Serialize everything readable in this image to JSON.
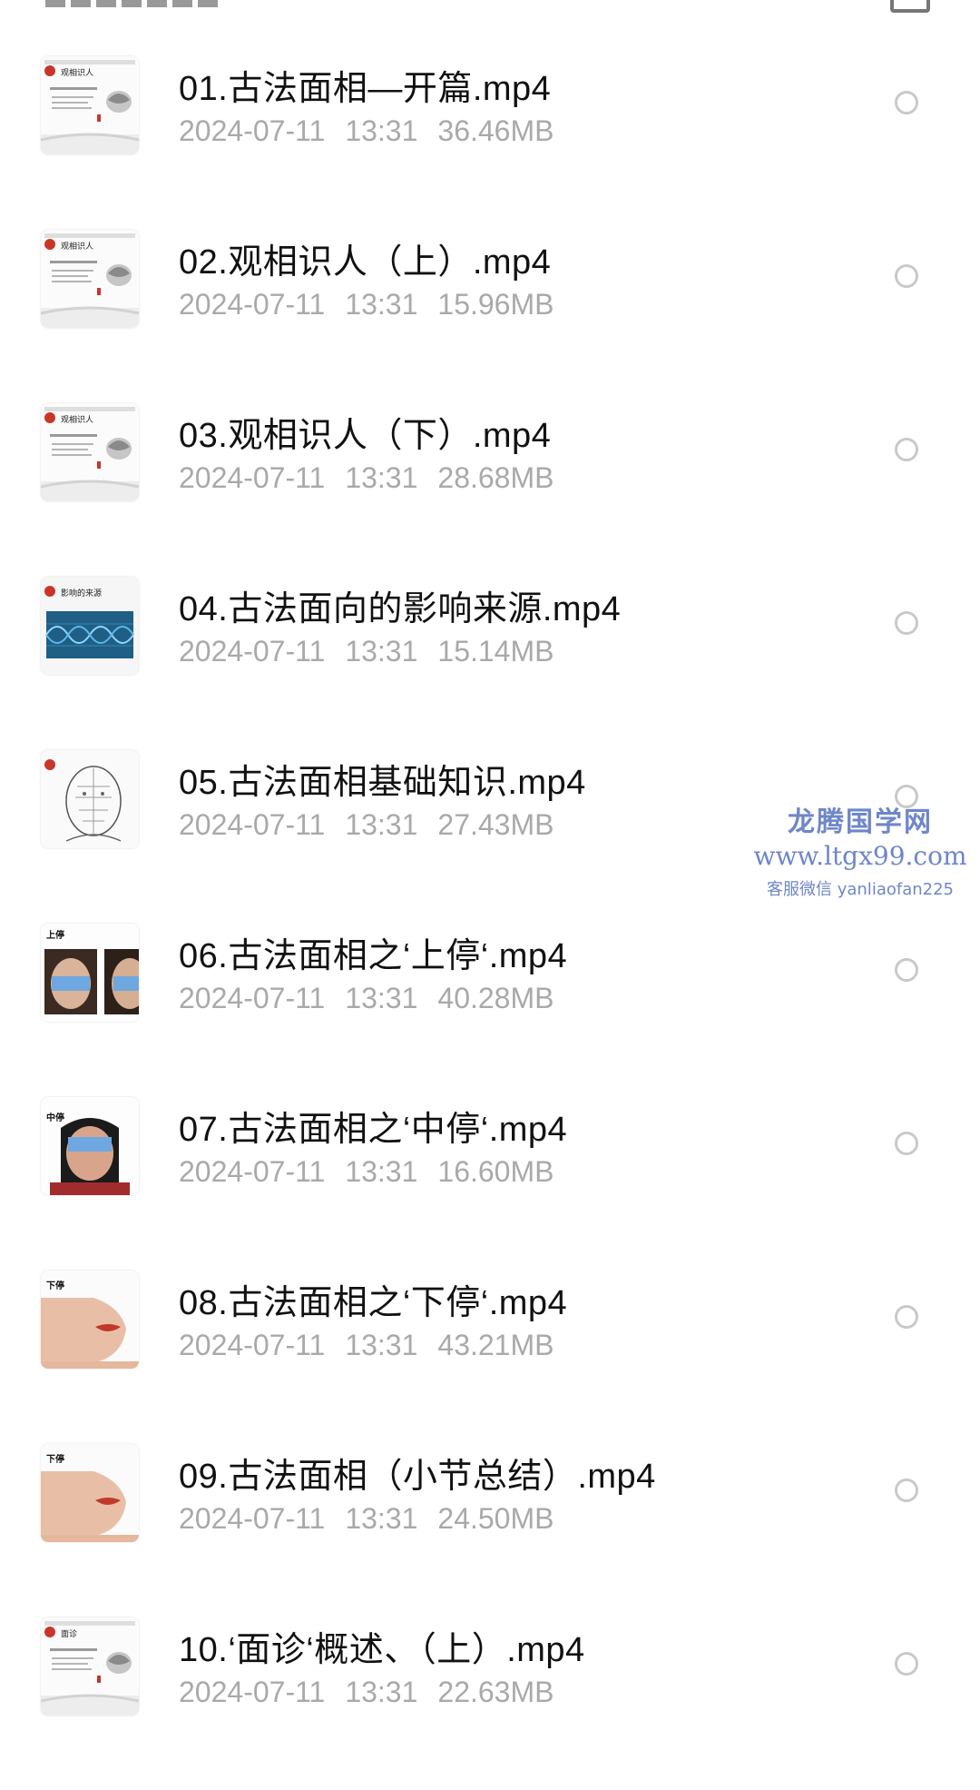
{
  "files": [
    {
      "name": "01.古法面相—开篇.mp4",
      "date": "2024-07-11",
      "time": "13:31",
      "size": "36.46MB",
      "thumb_label": "观相识人",
      "thumb_type": "slide"
    },
    {
      "name": "02.观相识人（上）.mp4",
      "date": "2024-07-11",
      "time": "13:31",
      "size": "15.96MB",
      "thumb_label": "观相识人",
      "thumb_type": "slide"
    },
    {
      "name": "03.观相识人（下）.mp4",
      "date": "2024-07-11",
      "time": "13:31",
      "size": "28.68MB",
      "thumb_label": "观相识人",
      "thumb_type": "slide"
    },
    {
      "name": "04.古法面向的影响来源.mp4",
      "date": "2024-07-11",
      "time": "13:31",
      "size": "15.14MB",
      "thumb_label": "影响的来源",
      "thumb_type": "dna"
    },
    {
      "name": "05.古法面相基础知识.mp4",
      "date": "2024-07-11",
      "time": "13:31",
      "size": "27.43MB",
      "thumb_label": "",
      "thumb_type": "face-chart"
    },
    {
      "name": "06.古法面相之‘上停‘.mp4",
      "date": "2024-07-11",
      "time": "13:31",
      "size": "40.28MB",
      "thumb_label": "上停",
      "thumb_type": "photo-faces"
    },
    {
      "name": "07.古法面相之‘中停‘.mp4",
      "date": "2024-07-11",
      "time": "13:31",
      "size": "16.60MB",
      "thumb_label": "中停",
      "thumb_type": "photo-face"
    },
    {
      "name": "08.古法面相之‘下停‘.mp4",
      "date": "2024-07-11",
      "time": "13:31",
      "size": "43.21MB",
      "thumb_label": "下停",
      "thumb_type": "chin"
    },
    {
      "name": "09.古法面相（小节总结）.mp4",
      "date": "2024-07-11",
      "time": "13:31",
      "size": "24.50MB",
      "thumb_label": "下停",
      "thumb_type": "chin"
    },
    {
      "name": "10.‘面诊‘概述、（上）.mp4",
      "date": "2024-07-11",
      "time": "13:31",
      "size": "22.63MB",
      "thumb_label": "面诊",
      "thumb_type": "slide"
    }
  ],
  "watermark": {
    "name": "龙腾国学网",
    "url": "www.ltgx99.com",
    "contact": "客服微信 yanliaofan225"
  },
  "icons": {
    "file_thumbnail": "video-thumbnail-icon",
    "selector": "radio-unchecked-icon"
  },
  "colors": {
    "title": "#111111",
    "meta": "#a9a9a9",
    "watermark": "#6f86c9",
    "radio": "#c9c9c9"
  }
}
